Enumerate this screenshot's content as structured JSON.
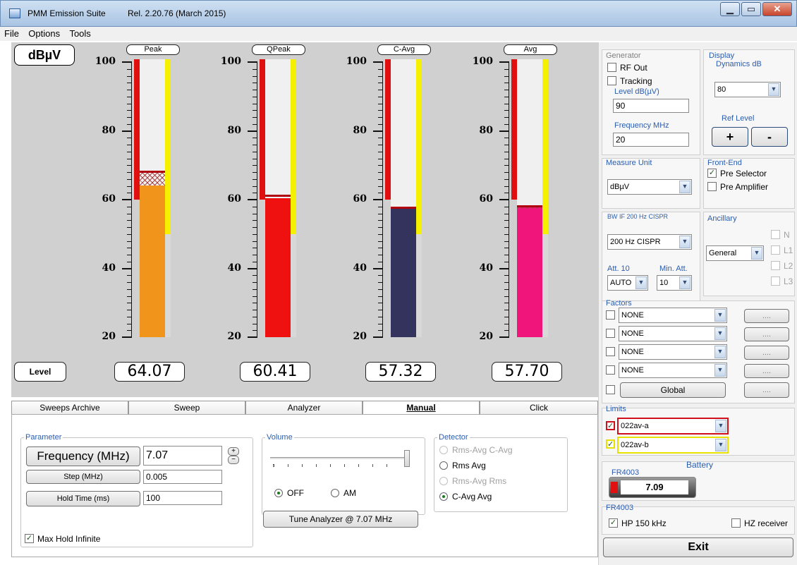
{
  "window": {
    "title": "PMM Emission Suite",
    "release": "Rel. 2.20.76 (March 2015)"
  },
  "menu": [
    "File",
    "Options",
    "Tools"
  ],
  "meters": {
    "unit": "dBµV",
    "level_button": "Level",
    "scale_labels": [
      "100",
      "80",
      "60",
      "40",
      "20"
    ],
    "scale_range": [
      20,
      100
    ],
    "detectors": [
      {
        "label": "Peak",
        "value": "64.07",
        "level": 64.07,
        "color": "#f0941c",
        "ref_red": 68,
        "show_cross": true
      },
      {
        "label": "QPeak",
        "value": "60.41",
        "level": 60.41,
        "color": "#ef1010",
        "ref_red": 61,
        "show_cross": false
      },
      {
        "label": "C-Avg",
        "value": "57.32",
        "level": 57.32,
        "color": "#33335e",
        "ref_red": 57.5,
        "show_cross": false
      },
      {
        "label": "Avg",
        "value": "57.70",
        "level": 57.7,
        "color": "#f0157a",
        "ref_red": 58,
        "show_cross": true
      }
    ]
  },
  "tabs": [
    "Sweeps Archive",
    "Sweep",
    "Analyzer",
    "Manual",
    "Click"
  ],
  "manual": {
    "parameter_title": "Parameter",
    "frequency_label": "Frequency (MHz)",
    "frequency_value": "7.07",
    "step_label": "Step (MHz)",
    "step_value": "0.005",
    "hold_label": "Hold Time (ms)",
    "hold_value": "100",
    "max_hold": "Max Hold Infinite",
    "volume_title": "Volume",
    "vol_off": "OFF",
    "vol_am": "AM",
    "tune_button": "Tune Analyzer @ 7.07 MHz",
    "detector_title": "Detector",
    "detector_options": [
      "Rms-Avg  C-Avg",
      "Rms  Avg",
      "Rms-Avg  Rms",
      "C-Avg  Avg"
    ]
  },
  "right": {
    "generator_title": "Generator",
    "rf_out": "RF Out",
    "tracking": "Tracking",
    "level_title": "Level dB(µV)",
    "level_value": "90",
    "freq_title": "Frequency MHz",
    "freq_value": "20",
    "display_title": "Display",
    "dynamics_title": "Dynamics dB",
    "dynamics_value": "80",
    "ref_level_title": "Ref Level",
    "plus": "+",
    "minus": "-",
    "measure_unit_title": "Measure Unit",
    "measure_unit_value": "dBµV",
    "frontend_title": "Front-End",
    "pre_selector": "Pre Selector",
    "pre_amplifier": "Pre Amplifier",
    "bw_title": "BW IF 200 Hz CISPR",
    "bw_value": "200 Hz CISPR",
    "ancillary_title": "Ancillary",
    "ancillary_value": "General",
    "ancillary_checks": [
      "N",
      "L1",
      "L2",
      "L3"
    ],
    "att_title": "Att. 10",
    "att_value": "AUTO",
    "minatt_title": "Min. Att.",
    "minatt_value": "10",
    "factors_title": "Factors",
    "factors": [
      "NONE",
      "NONE",
      "NONE",
      "NONE"
    ],
    "dots": "....",
    "global": "Global",
    "limits_title": "Limits",
    "limits": [
      {
        "value": "022av-a",
        "color": "#d0101a"
      },
      {
        "value": "022av-b",
        "color": "#e8e000"
      }
    ],
    "battery_title": "Battery",
    "fr_title": "FR4003",
    "battery_value": "7.09",
    "fr2_title": "FR4003",
    "hp": "HP 150 kHz",
    "hz_receiver": "HZ receiver",
    "exit": "Exit"
  }
}
